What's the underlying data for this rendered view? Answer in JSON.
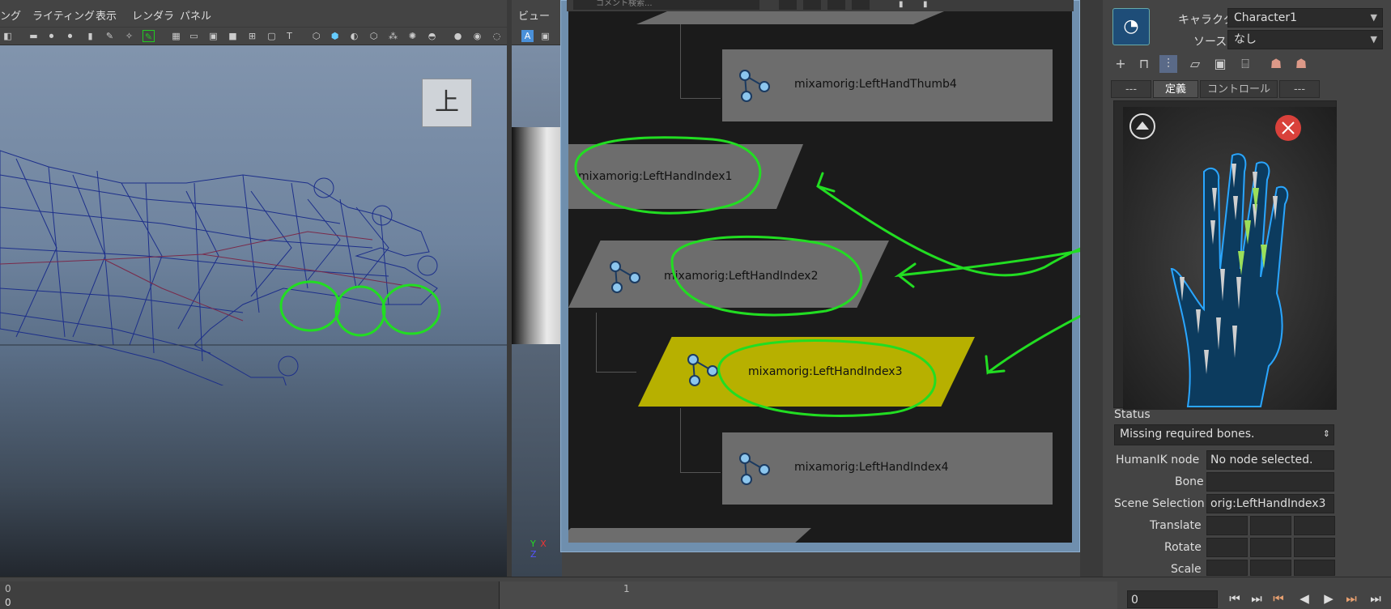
{
  "left_view": {
    "menu": [
      "ング",
      "ライティング",
      "表示",
      "レンダラ",
      "パネル"
    ],
    "view_cube_label": "上"
  },
  "right_view": {
    "menu": [
      "ビュー"
    ],
    "axis_labels": {
      "y": "Y",
      "x": "X",
      "z": "Z"
    }
  },
  "node_editor": {
    "search_placeholder": "コメント検索...",
    "nodes": [
      {
        "id": "thumb4",
        "label": "mixamorig:LeftHandThumb4",
        "selected": false
      },
      {
        "id": "index1",
        "label": "mixamorig:LeftHandIndex1",
        "selected": false
      },
      {
        "id": "index2",
        "label": "mixamorig:LeftHandIndex2",
        "selected": false
      },
      {
        "id": "index3",
        "label": "mixamorig:LeftHandIndex3",
        "selected": true
      },
      {
        "id": "index4",
        "label": "mixamorig:LeftHandIndex4",
        "selected": false
      }
    ]
  },
  "humanik": {
    "character_label": "キャラクタ:",
    "character_value": "Character1",
    "source_label": "ソース:",
    "source_value": "なし",
    "tabs": [
      "---",
      "定義",
      "コントロール",
      "---"
    ],
    "active_tab": "定義",
    "status_label": "Status",
    "status_value": "Missing required bones.",
    "humanik_node_label": "HumanIK node",
    "humanik_node_value": "No node selected.",
    "bone_label": "Bone",
    "scene_selection_label": "Scene Selection",
    "scene_selection_value": "orig:LeftHandIndex3",
    "translate_label": "Translate",
    "rotate_label": "Rotate",
    "scale_label": "Scale"
  },
  "timeline": {
    "start_value": "0",
    "start_value_2": "0",
    "mark_1": "1",
    "current_frame": "0"
  },
  "colors": {
    "accent_green": "#22dd22",
    "selected_node": "#b7b000",
    "node_gray": "#6d6d6d"
  }
}
